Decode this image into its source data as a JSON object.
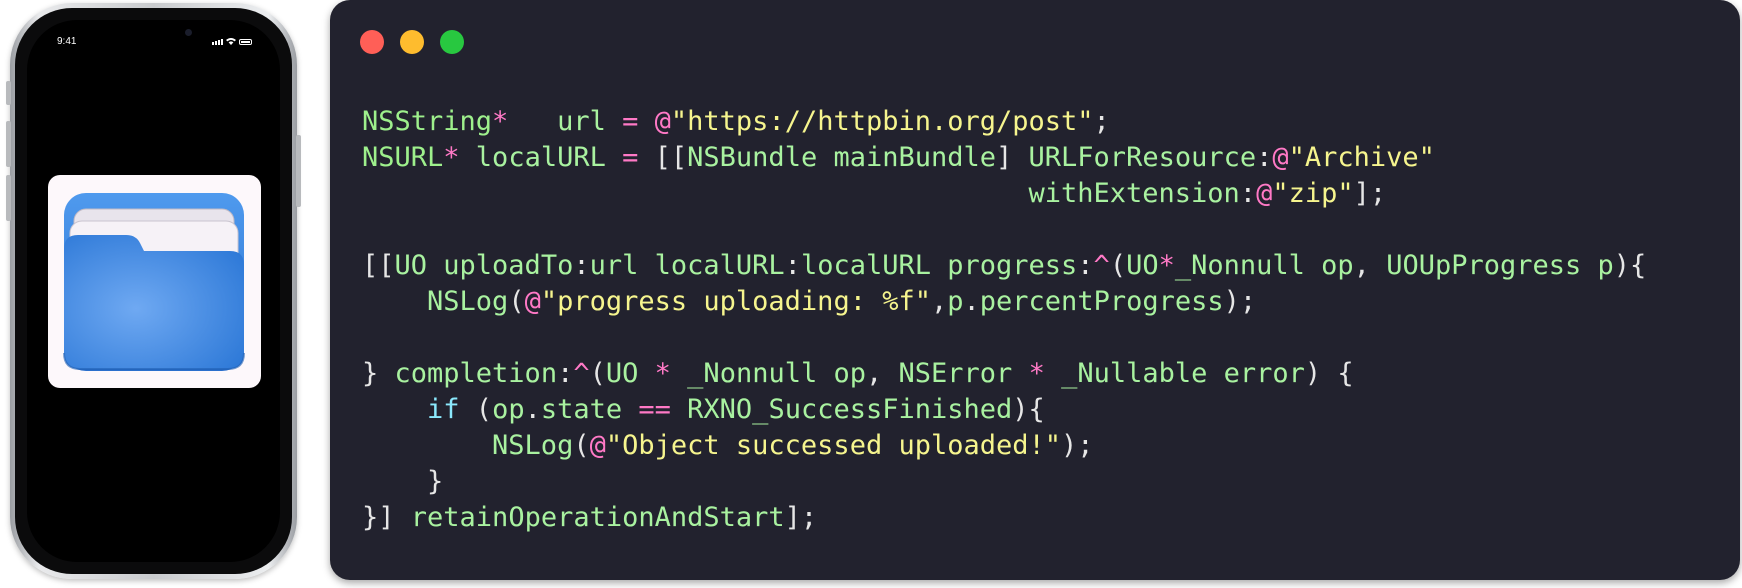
{
  "phone": {
    "status_time": "9:41",
    "app_icon": "files-folder-icon"
  },
  "window": {
    "controls": [
      "close",
      "minimize",
      "zoom"
    ]
  },
  "colors": {
    "window_bg": "#22222e",
    "close": "#ff5f57",
    "minimize": "#febc2e",
    "zoom": "#28c840",
    "type": "#9ef08c",
    "keyword": "#ff79c6",
    "string": "#f6f58e",
    "plain": "#e6e6e6",
    "if_keyword": "#8be9fd",
    "folder_blue": "#3f8fe6"
  },
  "code": {
    "lines": [
      [
        {
          "t": "NSString",
          "c": "type"
        },
        {
          "t": "*",
          "c": "kw"
        },
        {
          "t": "   url ",
          "c": "ident"
        },
        {
          "t": "=",
          "c": "kw"
        },
        {
          "t": " ",
          "c": "plain"
        },
        {
          "t": "@",
          "c": "kw"
        },
        {
          "t": "\"https://httpbin.org/post\"",
          "c": "str"
        },
        {
          "t": ";",
          "c": "plain"
        }
      ],
      [
        {
          "t": "NSURL",
          "c": "type"
        },
        {
          "t": "*",
          "c": "kw"
        },
        {
          "t": " localURL ",
          "c": "ident"
        },
        {
          "t": "=",
          "c": "kw"
        },
        {
          "t": " [[",
          "c": "plain"
        },
        {
          "t": "NSBundle mainBundle",
          "c": "ident"
        },
        {
          "t": "] ",
          "c": "plain"
        },
        {
          "t": "URLForResource",
          "c": "ident"
        },
        {
          "t": ":",
          "c": "plain"
        },
        {
          "t": "@",
          "c": "kw"
        },
        {
          "t": "\"Archive\"",
          "c": "str"
        }
      ],
      [
        {
          "t": "                                         withExtension",
          "c": "ident"
        },
        {
          "t": ":",
          "c": "plain"
        },
        {
          "t": "@",
          "c": "kw"
        },
        {
          "t": "\"zip\"",
          "c": "str"
        },
        {
          "t": "];",
          "c": "plain"
        }
      ],
      [],
      [
        {
          "t": "[[",
          "c": "plain"
        },
        {
          "t": "UO uploadTo",
          "c": "ident"
        },
        {
          "t": ":",
          "c": "plain"
        },
        {
          "t": "url localURL",
          "c": "ident"
        },
        {
          "t": ":",
          "c": "plain"
        },
        {
          "t": "localURL progress",
          "c": "ident"
        },
        {
          "t": ":",
          "c": "plain"
        },
        {
          "t": "^",
          "c": "kw"
        },
        {
          "t": "(",
          "c": "plain"
        },
        {
          "t": "UO",
          "c": "ident"
        },
        {
          "t": "*",
          "c": "kw"
        },
        {
          "t": "_Nonnull op",
          "c": "ident"
        },
        {
          "t": ", ",
          "c": "plain"
        },
        {
          "t": "UOUpProgress p",
          "c": "ident"
        },
        {
          "t": "){",
          "c": "plain"
        }
      ],
      [
        {
          "t": "    NSLog",
          "c": "ident"
        },
        {
          "t": "(",
          "c": "plain"
        },
        {
          "t": "@",
          "c": "kw"
        },
        {
          "t": "\"progress uploading: %f\"",
          "c": "str"
        },
        {
          "t": ",",
          "c": "plain"
        },
        {
          "t": "p",
          "c": "ident"
        },
        {
          "t": ".",
          "c": "plain"
        },
        {
          "t": "percentProgress",
          "c": "ident"
        },
        {
          "t": ");",
          "c": "plain"
        }
      ],
      [],
      [
        {
          "t": "} ",
          "c": "plain"
        },
        {
          "t": "completion",
          "c": "ident"
        },
        {
          "t": ":",
          "c": "plain"
        },
        {
          "t": "^",
          "c": "kw"
        },
        {
          "t": "(",
          "c": "plain"
        },
        {
          "t": "UO ",
          "c": "ident"
        },
        {
          "t": "*",
          "c": "kw"
        },
        {
          "t": " _Nonnull op",
          "c": "ident"
        },
        {
          "t": ", ",
          "c": "plain"
        },
        {
          "t": "NSError ",
          "c": "ident"
        },
        {
          "t": "*",
          "c": "kw"
        },
        {
          "t": " _Nullable error",
          "c": "ident"
        },
        {
          "t": ") {",
          "c": "plain"
        }
      ],
      [
        {
          "t": "    ",
          "c": "plain"
        },
        {
          "t": "if",
          "c": "if"
        },
        {
          "t": " (",
          "c": "plain"
        },
        {
          "t": "op",
          "c": "ident"
        },
        {
          "t": ".",
          "c": "plain"
        },
        {
          "t": "state ",
          "c": "ident"
        },
        {
          "t": "==",
          "c": "kw"
        },
        {
          "t": " RXNO_SuccessFinished",
          "c": "ident"
        },
        {
          "t": "){",
          "c": "plain"
        }
      ],
      [
        {
          "t": "        NSLog",
          "c": "ident"
        },
        {
          "t": "(",
          "c": "plain"
        },
        {
          "t": "@",
          "c": "kw"
        },
        {
          "t": "\"Object successed uploaded!\"",
          "c": "str"
        },
        {
          "t": ");",
          "c": "plain"
        }
      ],
      [
        {
          "t": "    }",
          "c": "plain"
        }
      ],
      [
        {
          "t": "}] ",
          "c": "plain"
        },
        {
          "t": "retainOperationAndStart",
          "c": "ident"
        },
        {
          "t": "];",
          "c": "plain"
        }
      ]
    ]
  }
}
